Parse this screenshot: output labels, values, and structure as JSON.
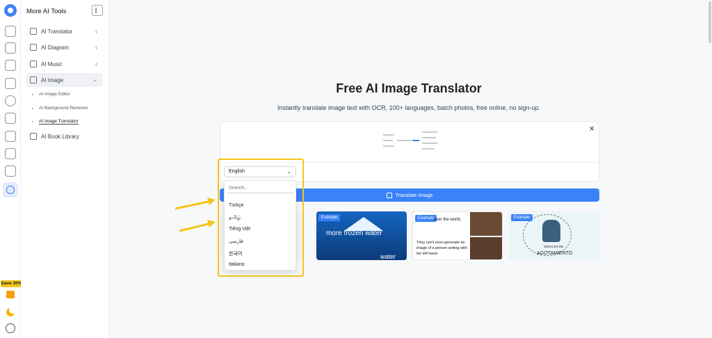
{
  "colors": {
    "accent": "#3b82f6",
    "highlight": "#f5c518"
  },
  "rail": {
    "save_badge": "Save 30%"
  },
  "sidebar": {
    "title": "More AI Tools",
    "items": [
      {
        "label": "AI Translator",
        "icon": "translate-icon"
      },
      {
        "label": "AI Diagram",
        "icon": "diagram-icon"
      },
      {
        "label": "AI Music",
        "icon": "music-icon"
      },
      {
        "label": "AI Image",
        "icon": "image-icon"
      }
    ],
    "sub_items": [
      "AI Image Editor",
      "AI Background Remover",
      "AI Image Translator"
    ],
    "library": "AI Book Library"
  },
  "main": {
    "title": "Free AI Image Translator",
    "subtitle": "Instantly translate image text with OCR, 100+ languages, batch photos, free online, no sign-up.",
    "close": "×",
    "language": {
      "selected": "English",
      "search_placeholder": "Search...",
      "options": [
        "Türkçe",
        "தமிழ்",
        "Tiếng Việt",
        "فارسی",
        "한국어",
        "Italiano"
      ]
    },
    "translate_button": "Translate Image",
    "examples": {
      "badge": "Example",
      "iceberg_top": "more frozen water",
      "iceberg_bottom": "water",
      "meme_top": "over the world.",
      "meme_bottom": "They can't even generate an image of a person writing with his left hand.",
      "poster_small": "SEÑALES DE",
      "poster_title": "AGOTAMIENTO"
    }
  }
}
